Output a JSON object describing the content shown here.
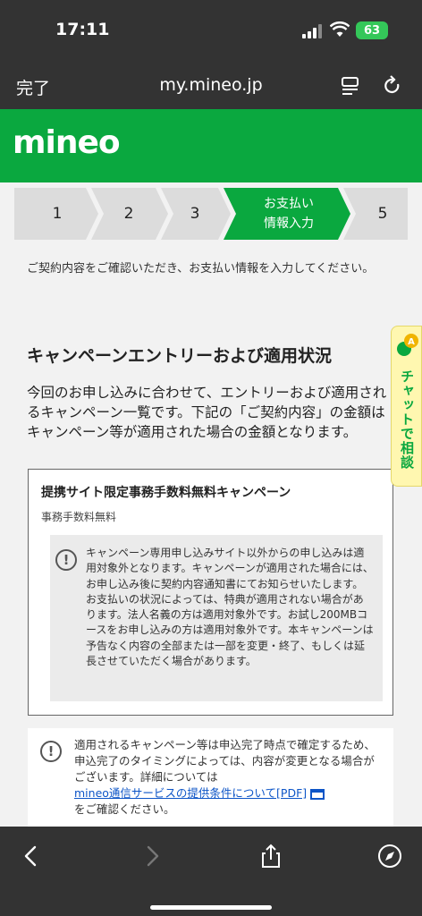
{
  "status": {
    "time": "17:11",
    "battery": "63"
  },
  "browser": {
    "done_label": "完了",
    "url": "my.mineo.jp"
  },
  "brand": {
    "logo": "mineo",
    "color": "#0aa83f"
  },
  "steps": [
    {
      "label": "1"
    },
    {
      "label": "2"
    },
    {
      "label": "3"
    },
    {
      "label_line1": "お支払い",
      "label_line2": "情報入力",
      "active": true
    },
    {
      "label": "5"
    }
  ],
  "intro": "ご契約内容をご確認いただき、お支払い情報を入力してください。",
  "section": {
    "title": "キャンペーンエントリーおよび適用状況",
    "description": "今回のお申し込みに合わせて、エントリーおよび適用されるキャンペーン一覧です。下記の「ご契約内容」の金額はキャンペーン等が適用された場合の金額となります。"
  },
  "campaign": {
    "title": "提携サイト限定事務手数料無料キャンペーン",
    "subtitle": "事務手数料無料",
    "notice": "キャンペーン専用申し込みサイト以外からの申し込みは適用対象外となります。キャンペーンが適用された場合には、お申し込み後に契約内容通知書にてお知らせいたします。お支払いの状況によっては、特典が適用されない場合があります。法人名義の方は適用対象外です。お試し200MBコースをお申し込みの方は適用対象外です。本キャンペーンは予告なく内容の全部または一部を変更・終了、もしくは延長させていただく場合があります。"
  },
  "note": {
    "text_before": "適用されるキャンペーン等は申込完了時点で確定するため、申込完了のタイミングによっては、内容が変更となる場合がございます。詳細については",
    "link": "mineo通信サービスの提供条件について[PDF]",
    "text_after": "をご確認ください。"
  },
  "chat": {
    "badge": "A",
    "label": "チャットで相談"
  }
}
